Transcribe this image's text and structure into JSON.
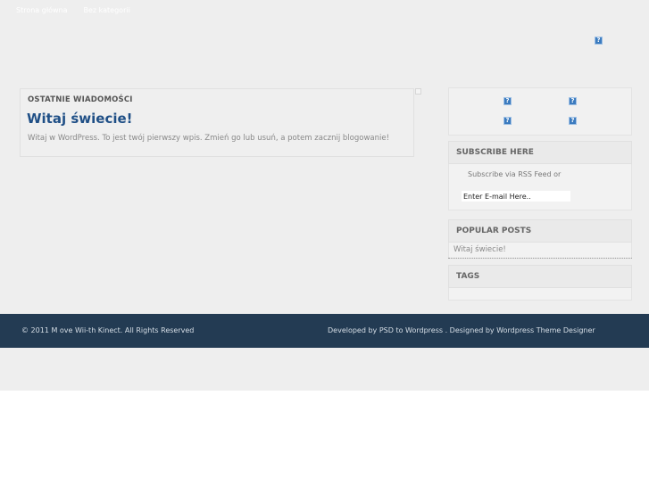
{
  "nav": {
    "items": [
      "Strona główna",
      "Bez kategorii"
    ]
  },
  "main": {
    "heading": "OSTATNIE WIADOMOŚCI",
    "post_title": "Witaj świecie!",
    "post_excerpt": "Witaj w WordPress. To jest twój pierwszy wpis. Zmień go lub usuń, a potem zacznij blogowanie!"
  },
  "sidebar": {
    "subscribe_title": "SUBSCRIBE HERE",
    "subscribe_text": "Subscribe via RSS Feed or",
    "email_value": "Enter E-mail Here..",
    "popular_title": "POPULAR POSTS",
    "popular_items": [
      "Witaj świecie!"
    ],
    "tags_title": "TAGS"
  },
  "icons": {
    "broken_image_glyph": "?"
  },
  "footer": {
    "copyright": "© 2011 M ove Wii-th Kinect. All Rights Reserved",
    "credits": "Developed by PSD to Wordpress . Designed by Wordpress Theme Designer"
  },
  "colors": {
    "footer_bg": "#233b53",
    "title_blue": "#1f4f86"
  }
}
